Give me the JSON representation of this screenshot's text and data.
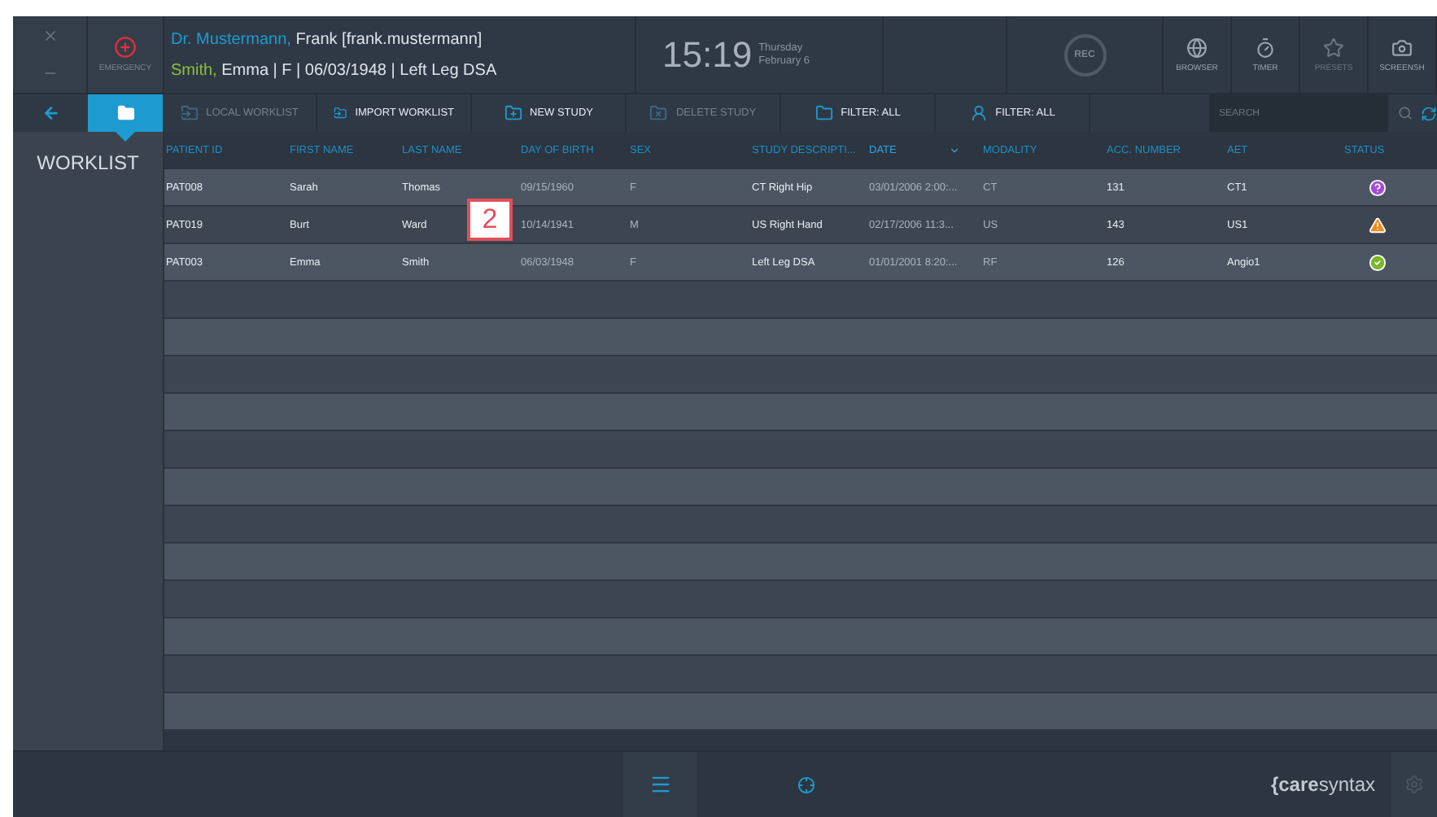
{
  "window_controls": {
    "emergency_label": "EMERGENCY"
  },
  "user": {
    "title_name": "Dr. Mustermann,",
    "name": "Frank [frank.mustermann]"
  },
  "patient": {
    "last_name": "Smith,",
    "details": "Emma | F | 06/03/1948 | Left Leg DSA"
  },
  "clock": {
    "time": "15:19",
    "weekday": "Thursday",
    "date": "February 6"
  },
  "record": {
    "label": "REC"
  },
  "apps": [
    {
      "kind": "browser",
      "label": "BROWSER",
      "disabled": false
    },
    {
      "kind": "timer",
      "label": "TIMER",
      "disabled": false
    },
    {
      "kind": "presets",
      "label": "PRESETS",
      "disabled": true
    },
    {
      "kind": "screenshot",
      "label": "SCREENSH",
      "disabled": false
    }
  ],
  "nav": [
    {
      "kind": "back",
      "selected": false
    },
    {
      "kind": "worklist",
      "selected": true
    }
  ],
  "toolbar": [
    {
      "kind": "local",
      "label": "LOCAL WORKLIST",
      "disabled": true
    },
    {
      "kind": "import",
      "label": "IMPORT WORKLIST",
      "disabled": false
    },
    {
      "kind": "new",
      "label": "NEW STUDY",
      "disabled": false
    },
    {
      "kind": "delete",
      "label": "DELETE STUDY",
      "disabled": true
    },
    {
      "kind": "filter-folder",
      "label": "FILTER: ALL",
      "disabled": false
    },
    {
      "kind": "filter-person",
      "label": "FILTER: ALL",
      "disabled": false
    }
  ],
  "search": {
    "placeholder": "SEARCH"
  },
  "sidebar": {
    "title": "WORKLIST"
  },
  "table": {
    "columns": [
      {
        "label": "PATIENT ID",
        "sorted": false
      },
      {
        "label": "FIRST NAME",
        "sorted": false
      },
      {
        "label": "LAST NAME",
        "sorted": false
      },
      {
        "label": "DAY OF BIRTH",
        "sorted": false
      },
      {
        "label": "SEX",
        "sorted": false
      },
      {
        "label": "STUDY DESCRIPTI...",
        "sorted": false
      },
      {
        "label": "DATE",
        "sorted": true
      },
      {
        "label": "MODALITY",
        "sorted": false
      },
      {
        "label": "ACC. NUMBER",
        "sorted": false
      },
      {
        "label": "AET",
        "sorted": false
      },
      {
        "label": "STATUS",
        "sorted": false
      }
    ],
    "rows": [
      {
        "cells": [
          "PAT008",
          "Sarah",
          "Thomas",
          "09/15/1960",
          "F",
          "CT Right Hip",
          "03/01/2006 2:00:...",
          "CT",
          "131",
          "CT1"
        ],
        "status_icon": {
          "kind": "question"
        }
      },
      {
        "cells": [
          "PAT019",
          "Burt",
          "Ward",
          "10/14/1941",
          "M",
          "US Right Hand",
          "02/17/2006 11:3...",
          "US",
          "143",
          "US1"
        ],
        "status_icon": {
          "kind": "warning"
        }
      },
      {
        "cells": [
          "PAT003",
          "Emma",
          "Smith",
          "06/03/1948",
          "F",
          "Left Leg DSA",
          "01/01/2001 8:20:...",
          "RF",
          "126",
          "Angio1"
        ],
        "status_icon": {
          "kind": "check"
        }
      }
    ]
  },
  "callout": {
    "number": "2"
  },
  "footer": {
    "logo_bold": "{care",
    "logo_light": "syntax"
  }
}
